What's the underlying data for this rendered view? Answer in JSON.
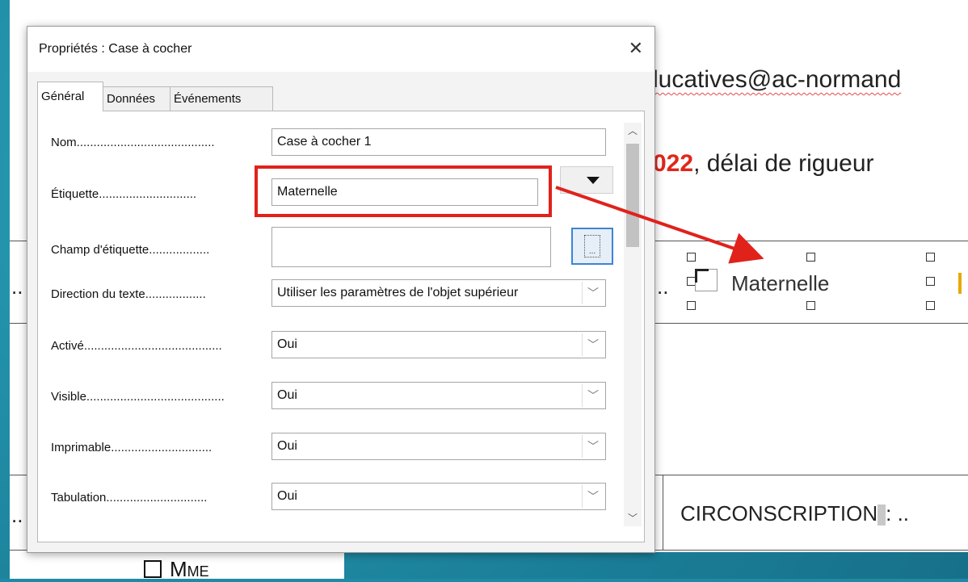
{
  "document": {
    "email_fragment": "lucatives@ac-normand",
    "deadline_red": "022",
    "deadline_rest": ", délai de rigueur",
    "checkbox_label": "Maternelle",
    "circonscription": "CIRCONSCRIPTION",
    "circonscription_suffix": ": ..",
    "ellipsis_left": "..",
    "ellipsis_mid": "..",
    "ellipsis_left2": "..",
    "mme_label": "Mme"
  },
  "dialog": {
    "title": "Propriétés : Case à cocher",
    "close": "✕",
    "tabs": [
      "Général",
      "Données",
      "Événements"
    ],
    "rows": [
      {
        "label": "Nom",
        "value": "Case à cocher 1"
      },
      {
        "label": "Étiquette",
        "value": "Maternelle"
      },
      {
        "label": "Champ d'étiquette",
        "value": ""
      },
      {
        "label": "Direction du texte",
        "value": "Utiliser les paramètres de l'objet supérieur"
      },
      {
        "label": "Activé",
        "value": "Oui"
      },
      {
        "label": "Visible",
        "value": "Oui"
      },
      {
        "label": "Imprimable",
        "value": "Oui"
      },
      {
        "label": "Tabulation",
        "value": "Oui"
      }
    ]
  },
  "colors": {
    "annotation": "#e0221b",
    "background": "#1f8aa6"
  }
}
